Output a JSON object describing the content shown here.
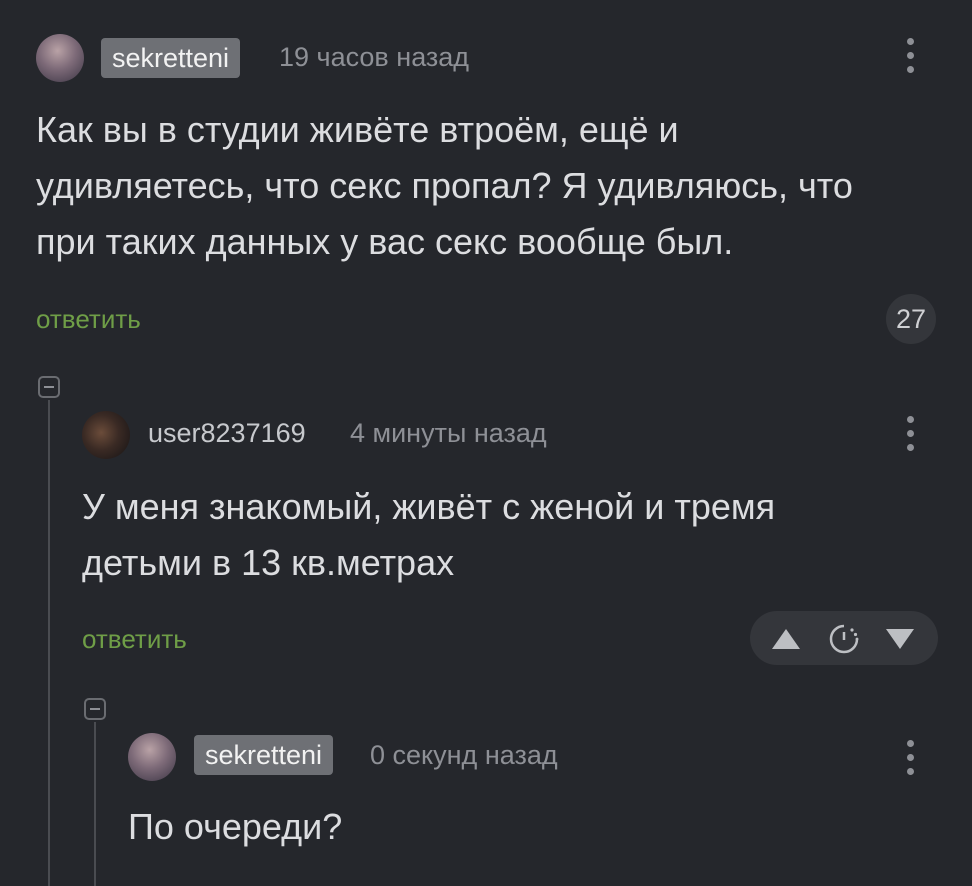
{
  "comments": [
    {
      "author": "sekretteni",
      "time": "19 часов назад",
      "lines": [
        "Как вы в студии живёте втроём, ещё и",
        "удивляетесь, что секс пропал? Я удивляюсь, что",
        "при таких данных у вас секс вообще был."
      ],
      "reply_label": "ответить",
      "rating": "27",
      "author_badge": true
    },
    {
      "author": "user8237169",
      "time": "4 минуты назад",
      "lines": [
        "У меня знакомый, живёт с женой и тремя",
        "детьми в 13 кв.метрах"
      ],
      "reply_label": "ответить",
      "author_badge": false
    },
    {
      "author": "sekretteni",
      "time": "0 секунд назад",
      "lines": [
        "По очереди?"
      ],
      "author_badge": true
    }
  ],
  "icons": {
    "vote_up": "triangle-up-icon",
    "vote_timer": "clock-icon",
    "vote_down": "triangle-down-icon",
    "menu": "kebab-menu-icon",
    "collapse": "collapse-minus-icon"
  },
  "colors": {
    "background": "#25272c",
    "reply_link": "#6f9e47",
    "badge": "#6e7075"
  }
}
